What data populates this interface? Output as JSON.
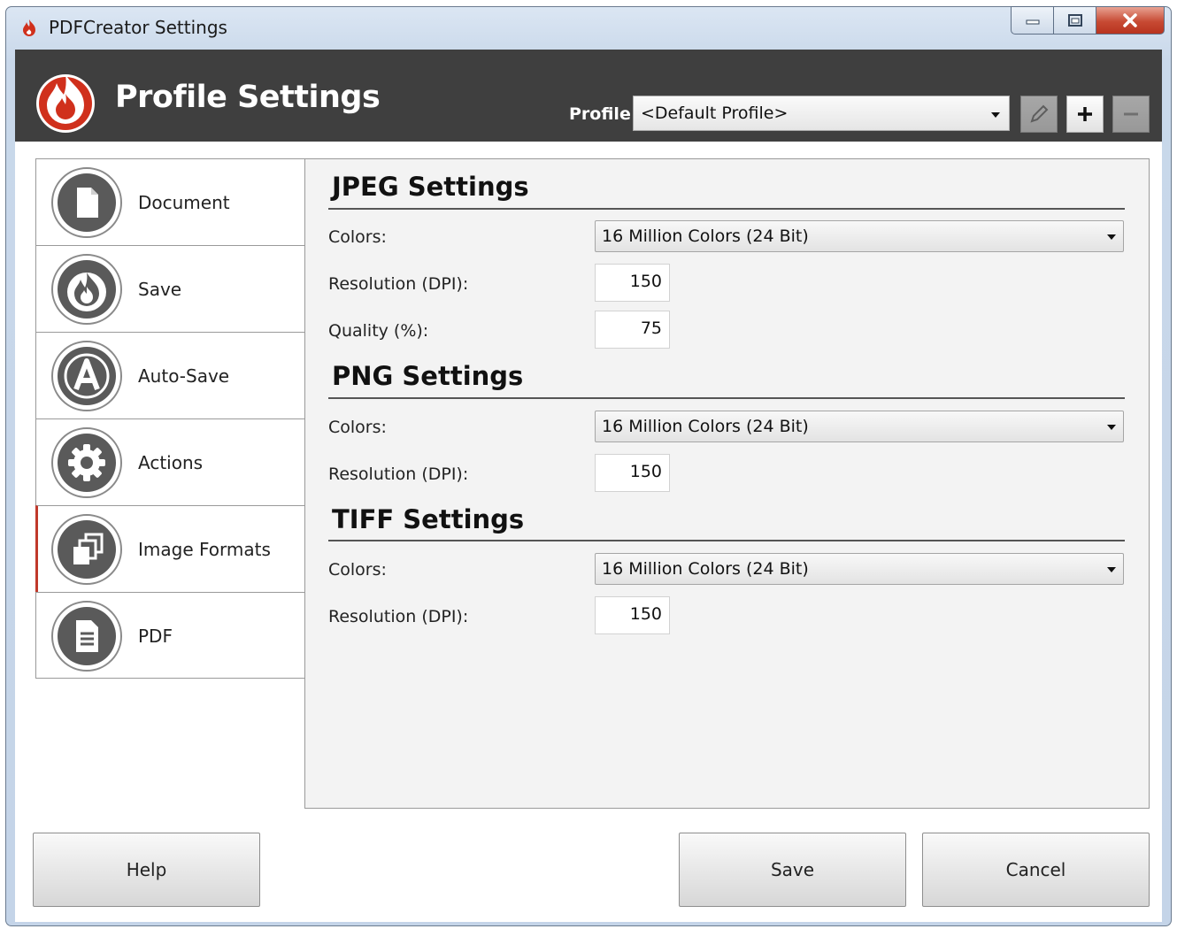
{
  "window": {
    "title": "PDFCreator Settings"
  },
  "header": {
    "title": "Profile Settings",
    "profile_label": "Profile:",
    "profile_value": "<Default Profile>"
  },
  "nav": {
    "items": [
      {
        "label": "Document",
        "icon": "document-icon"
      },
      {
        "label": "Save",
        "icon": "flame-icon"
      },
      {
        "label": "Auto-Save",
        "icon": "auto-save-a-icon"
      },
      {
        "label": "Actions",
        "icon": "gear-icon"
      },
      {
        "label": "Image Formats",
        "icon": "image-formats-icon",
        "active": true
      },
      {
        "label": "PDF",
        "icon": "pdf-document-icon"
      }
    ]
  },
  "jpeg": {
    "title": "JPEG Settings",
    "colors_label": "Colors:",
    "colors_value": "16 Million Colors (24 Bit)",
    "resolution_label": "Resolution (DPI):",
    "resolution_value": "150",
    "quality_label": "Quality (%):",
    "quality_value": "75"
  },
  "png": {
    "title": "PNG Settings",
    "colors_label": "Colors:",
    "colors_value": "16 Million Colors (24 Bit)",
    "resolution_label": "Resolution (DPI):",
    "resolution_value": "150"
  },
  "tiff": {
    "title": "TIFF Settings",
    "colors_label": "Colors:",
    "colors_value": "16 Million Colors (24 Bit)",
    "resolution_label": "Resolution (DPI):",
    "resolution_value": "150"
  },
  "footer": {
    "help_label": "Help",
    "save_label": "Save",
    "cancel_label": "Cancel"
  },
  "colors": {
    "header_bg": "#3f3f3f",
    "accent_red": "#c0392b",
    "panel_bg": "#f3f3f3"
  }
}
